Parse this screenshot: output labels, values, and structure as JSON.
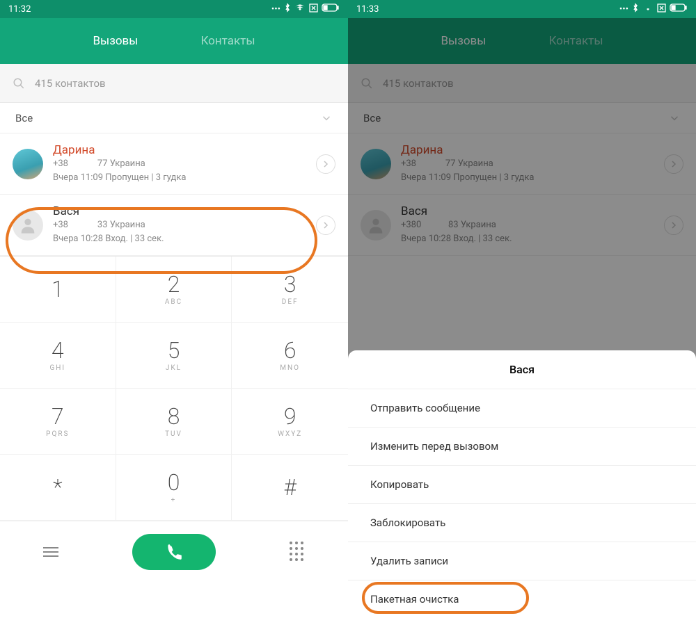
{
  "left": {
    "time": "11:32",
    "tabs": {
      "calls": "Вызовы",
      "contacts": "Контакты"
    },
    "search_placeholder": "415 контактов",
    "filter": "Все",
    "calls": [
      {
        "name": "Дарина",
        "prefix": "+38",
        "suffix": "77  Украина",
        "meta": "Вчера 11:09 Пропущен | 3 гудка",
        "missed": true
      },
      {
        "name": "Вася",
        "prefix": "+38",
        "suffix": "33  Украина",
        "meta": "Вчера 10:28 Вход. | 33 сек.",
        "missed": false
      }
    ],
    "keys": [
      {
        "n": "1",
        "l": ""
      },
      {
        "n": "2",
        "l": "ABC"
      },
      {
        "n": "3",
        "l": "DEF"
      },
      {
        "n": "4",
        "l": "GHI"
      },
      {
        "n": "5",
        "l": "JKL"
      },
      {
        "n": "6",
        "l": "MNO"
      },
      {
        "n": "7",
        "l": "PQRS"
      },
      {
        "n": "8",
        "l": "TUV"
      },
      {
        "n": "9",
        "l": "WXYZ"
      },
      {
        "n": "*",
        "l": ""
      },
      {
        "n": "0",
        "l": "+"
      },
      {
        "n": "#",
        "l": ""
      }
    ]
  },
  "right": {
    "time": "11:33",
    "tabs": {
      "calls": "Вызовы",
      "contacts": "Контакты"
    },
    "search_placeholder": "415 контактов",
    "filter": "Все",
    "calls": [
      {
        "name": "Дарина",
        "prefix": "+38",
        "suffix": "77  Украина",
        "meta": "Вчера 11:09 Пропущен | 3 гудка",
        "missed": true
      },
      {
        "name": "Вася",
        "prefix": "+380",
        "suffix": "83  Украина",
        "meta": "Вчера 10:28 Вход. | 33 сек.",
        "missed": false
      }
    ],
    "menu": {
      "title": "Вася",
      "items": [
        "Отправить сообщение",
        "Изменить перед вызовом",
        "Копировать",
        "Заблокировать",
        "Удалить записи",
        "Пакетная очистка"
      ]
    }
  }
}
